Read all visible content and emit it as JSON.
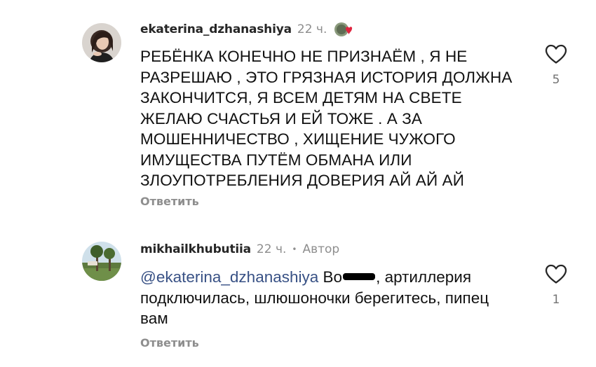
{
  "comments": [
    {
      "username": "ekaterina_dzhanashiya",
      "time": "22 ч.",
      "text": "РЕБЁНКА КОНЕЧНО НЕ ПРИЗНАЁМ , Я НЕ РАЗРЕШАЮ , ЭТО ГРЯЗНАЯ ИСТОРИЯ ДОЛЖНА ЗАКОНЧИТСЯ, Я ВСЕМ ДЕТЯМ НА СВЕТЕ ЖЕЛАЮ СЧАСТЬЯ И ЕЙ ТОЖЕ . А ЗА МОШЕННИЧЕСТВО , ХИЩЕНИЕ ЧУЖОГО ИМУЩЕСТВА ПУТЁМ ОБМАНА ИЛИ ЗЛОУПОТРЕБЛЕНИЯ  ДОВЕРИЯ АЙ АЙ АЙ",
      "reply_label": "Ответить",
      "like_count": "5",
      "badge_icon": "story-heart-badge-icon"
    },
    {
      "username": "mikhailkhubutiia",
      "time": "22 ч.",
      "separator": "•",
      "author_label": "Автор",
      "mention": "@ekaterina_dzhanashiya",
      "text_prefix": "Во",
      "text_rest": ", артиллерия подключилась, шлюшоночки берегитесь, пипец вам",
      "reply_label": "Ответить",
      "like_count": "1"
    }
  ],
  "colors": {
    "username": "#262626",
    "secondary": "#8e8e8e",
    "mention": "#385185",
    "text": "#111111"
  }
}
